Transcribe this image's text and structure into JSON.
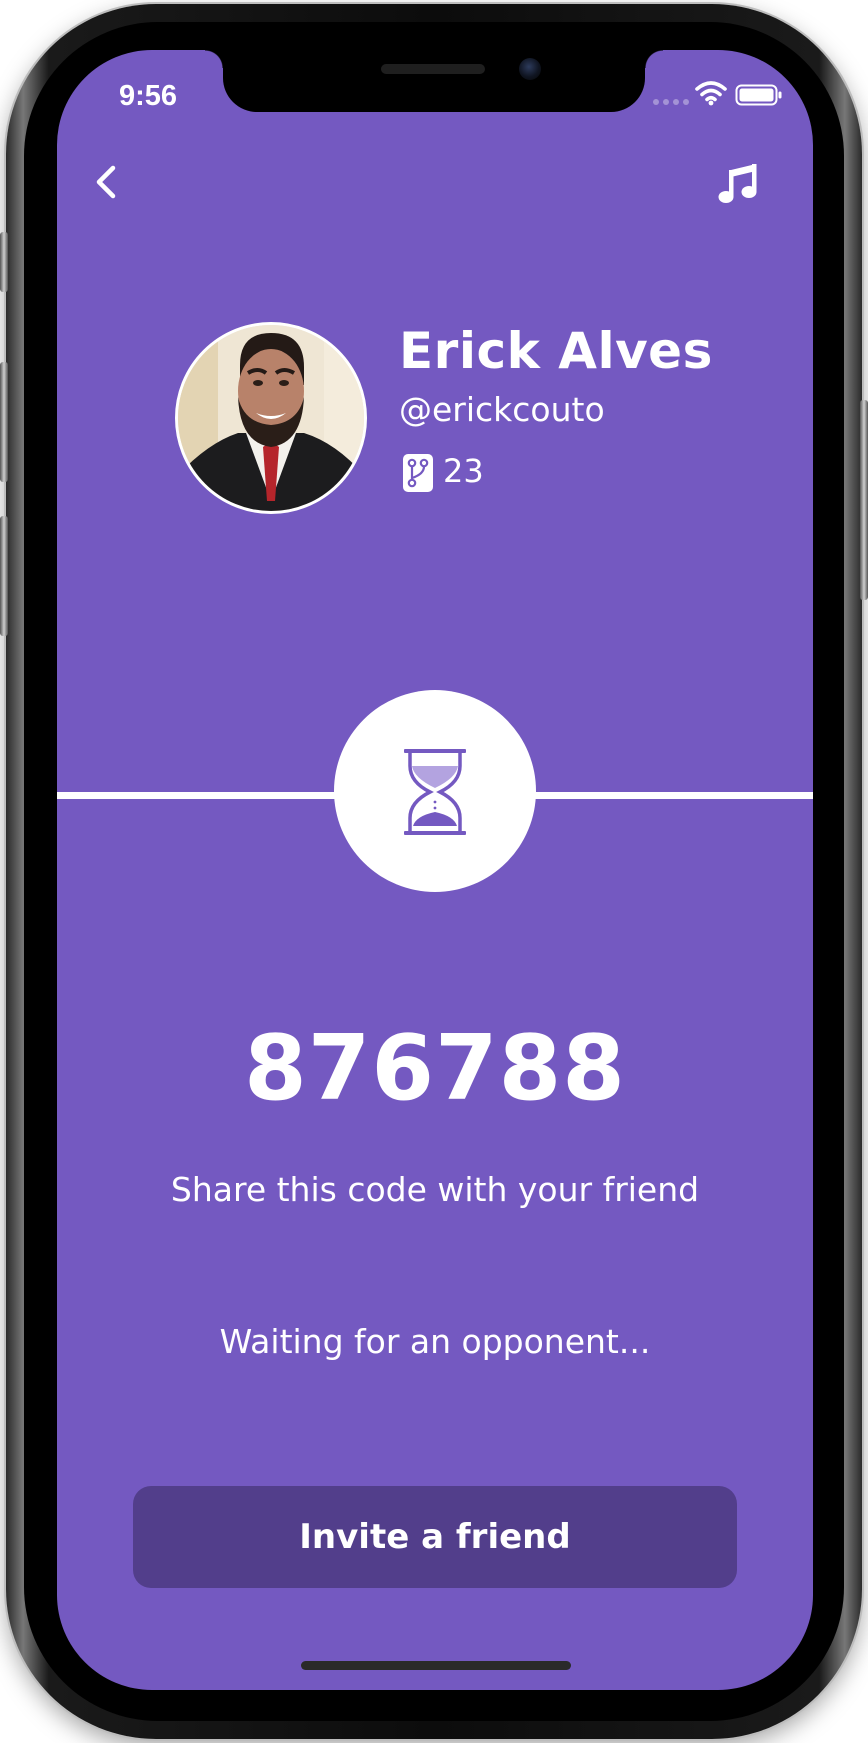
{
  "status_bar": {
    "time": "9:56"
  },
  "nav": {
    "back_icon": "chevron-left-icon",
    "music_icon": "music-note-icon"
  },
  "profile": {
    "name": "Erick Alves",
    "handle": "@erickcouto",
    "repo_icon": "git-branch-icon",
    "repo_count": "23"
  },
  "match": {
    "status_icon": "hourglass-icon",
    "code": "876788",
    "share_hint": "Share this code with your friend",
    "waiting_text": "Waiting for an opponent..."
  },
  "actions": {
    "invite_label": "Invite a friend"
  },
  "colors": {
    "background": "#7459c1",
    "button": "#523e8b",
    "foreground": "#ffffff"
  }
}
